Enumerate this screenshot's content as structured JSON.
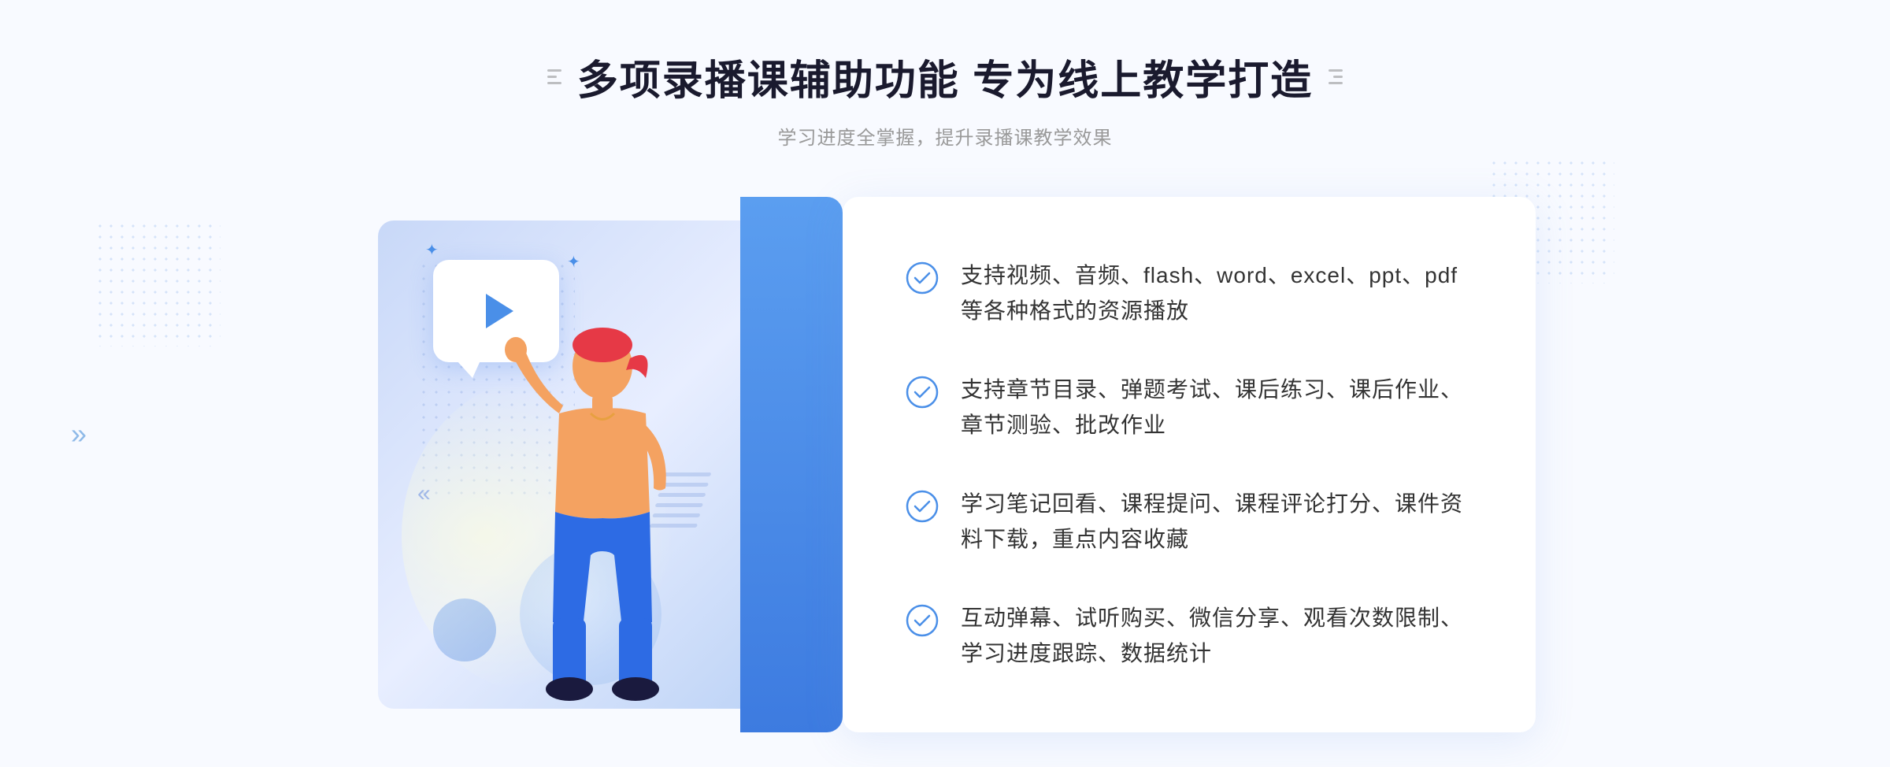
{
  "header": {
    "title": "多项录播课辅助功能 专为线上教学打造",
    "subtitle": "学习进度全掌握，提升录播课教学效果"
  },
  "features": [
    {
      "id": 1,
      "text": "支持视频、音频、flash、word、excel、ppt、pdf等各种格式的资源播放"
    },
    {
      "id": 2,
      "text": "支持章节目录、弹题考试、课后练习、课后作业、章节测验、批改作业"
    },
    {
      "id": 3,
      "text": "学习笔记回看、课程提问、课程评论打分、课件资料下载，重点内容收藏"
    },
    {
      "id": 4,
      "text": "互动弹幕、试听购买、微信分享、观看次数限制、学习进度跟踪、数据统计"
    }
  ],
  "colors": {
    "primary_blue": "#4a8fe8",
    "light_blue": "#e8f0fe",
    "text_dark": "#1a1a2e",
    "text_gray": "#999999",
    "text_body": "#333333"
  }
}
